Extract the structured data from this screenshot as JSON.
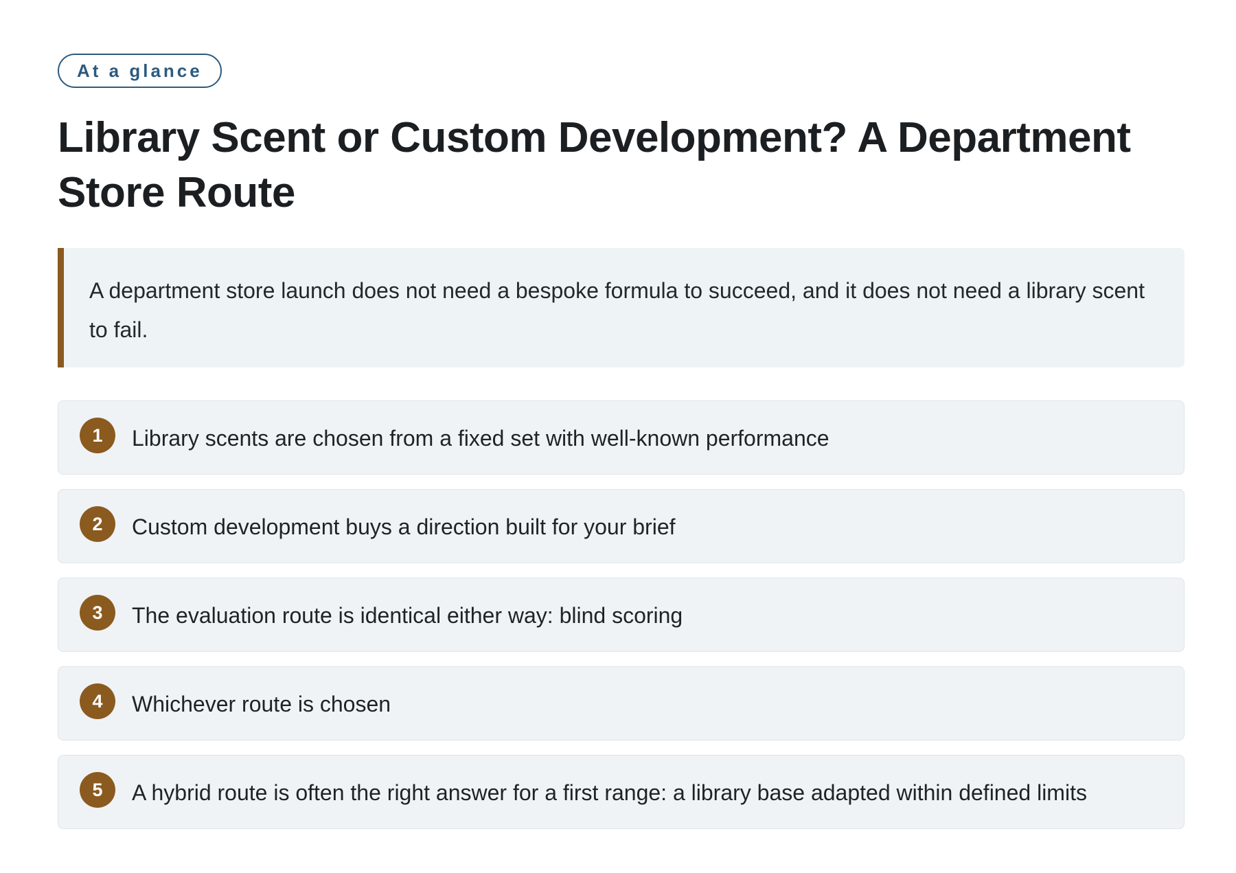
{
  "badge": "At a glance",
  "title": "Library Scent or Custom Development? A Department Store Route",
  "callout": "A department store launch does not need a bespoke formula to succeed, and it does not need a library scent to fail.",
  "items": [
    {
      "number": "1",
      "text": "Library scents are chosen from a fixed set with well-known performance"
    },
    {
      "number": "2",
      "text": "Custom development buys a direction built for your brief"
    },
    {
      "number": "3",
      "text": "The evaluation route is identical either way: blind scoring"
    },
    {
      "number": "4",
      "text": "Whichever route is chosen"
    },
    {
      "number": "5",
      "text": "A hybrid route is often the right answer for a first range: a library base adapted within defined limits"
    }
  ],
  "colors": {
    "accent": "#8a5a20",
    "badge": "#2c5a7e",
    "panel": "#eef3f6",
    "text": "#1f2326"
  }
}
